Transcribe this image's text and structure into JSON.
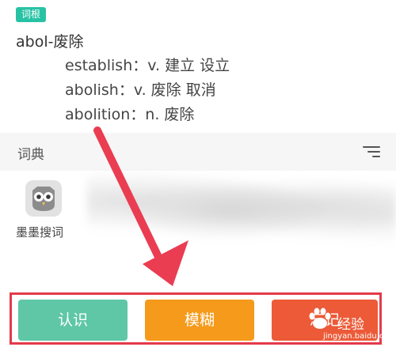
{
  "root": {
    "badge": "词根",
    "word": "abol-废除"
  },
  "derived": [
    {
      "text": "establish：v. 建立 设立"
    },
    {
      "text": "abolish：v. 废除 取消"
    },
    {
      "text": "abolition：n. 废除"
    }
  ],
  "dictionary": {
    "title": "词典",
    "filter_icon": "filter-icon",
    "app_name": "墨墨搜词",
    "app_icon": "owl-icon"
  },
  "answers": {
    "know": "认识",
    "vague": "模糊",
    "forget": "忘记"
  },
  "watermark": {
    "text": "经验",
    "site": "jingyan.baidu.com"
  },
  "colors": {
    "badge": "#27c2a4",
    "know": "#5fc7a6",
    "vague": "#f59a1b",
    "forget": "#ec5a37",
    "highlight": "#e33a4a"
  }
}
